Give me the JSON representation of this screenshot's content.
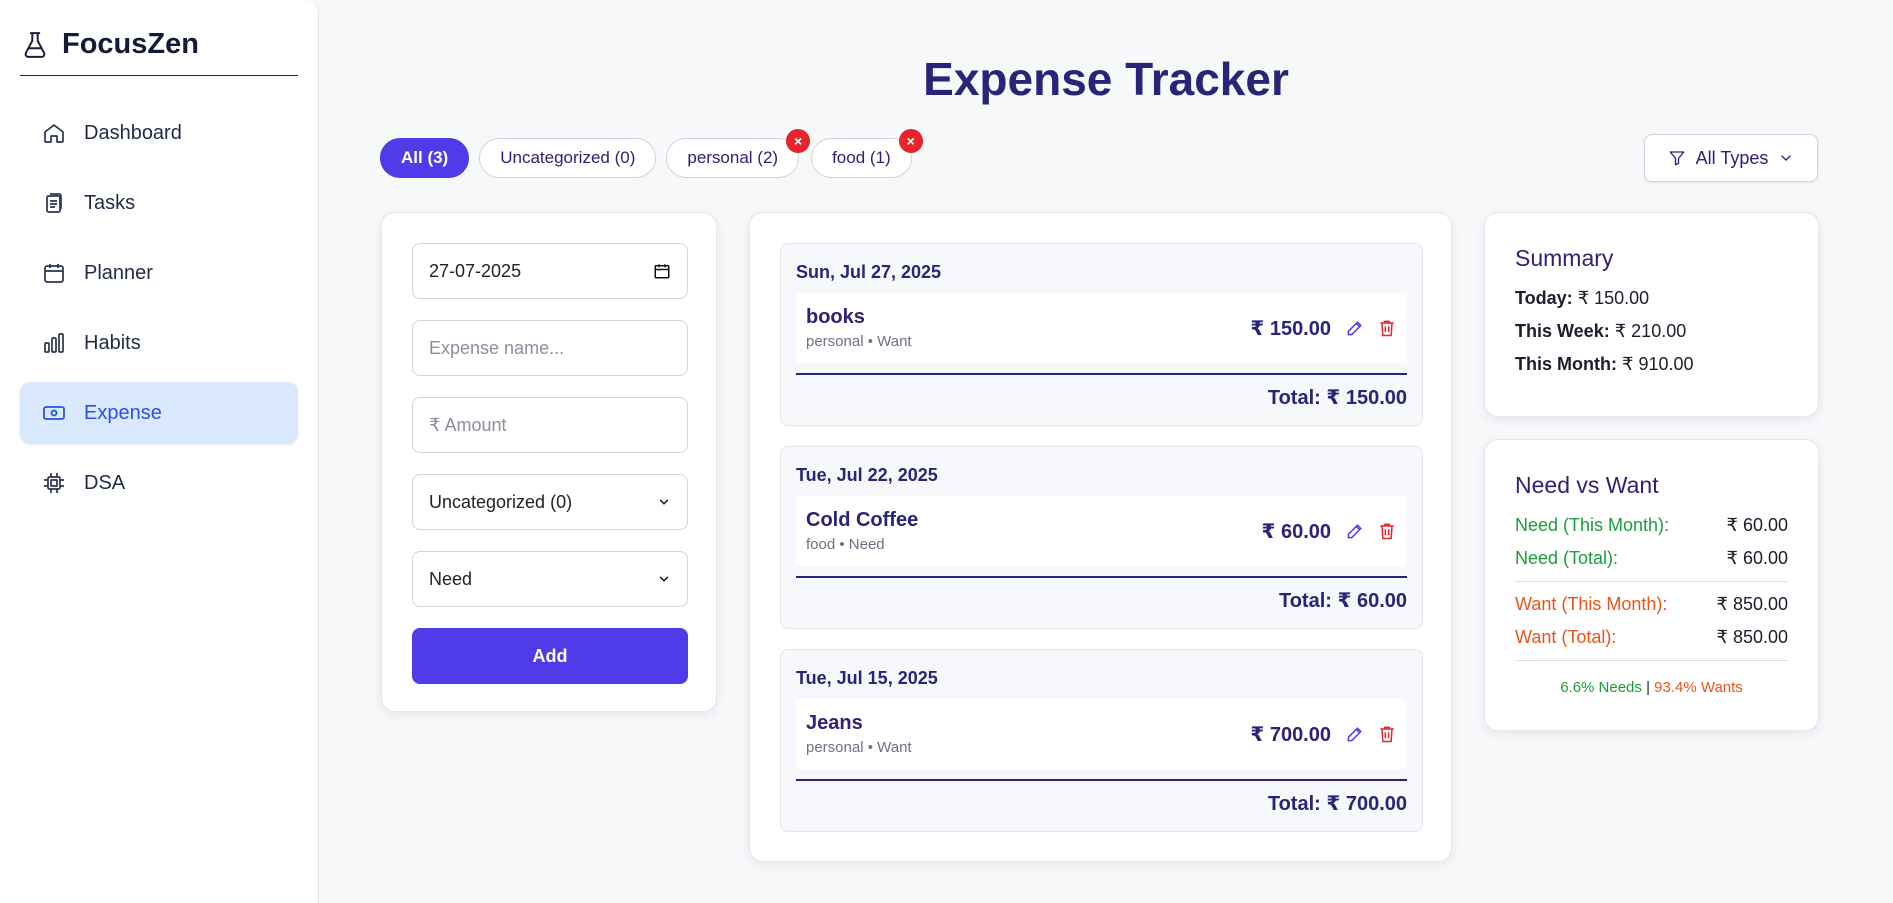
{
  "app": {
    "name": "FocusZen",
    "logo_icon": "flask-icon"
  },
  "sidebar": {
    "items": [
      {
        "label": "Dashboard",
        "icon": "home-icon"
      },
      {
        "label": "Tasks",
        "icon": "clipboard-icon"
      },
      {
        "label": "Planner",
        "icon": "calendar-icon"
      },
      {
        "label": "Habits",
        "icon": "bar-chart-icon"
      },
      {
        "label": "Expense",
        "icon": "cash-icon",
        "active": true
      },
      {
        "label": "DSA",
        "icon": "chip-icon"
      }
    ]
  },
  "page": {
    "title": "Expense Tracker"
  },
  "filters": {
    "chips": [
      {
        "label": "All (3)",
        "active": true
      },
      {
        "label": "Uncategorized (0)"
      },
      {
        "label": "personal (2)",
        "removable": true,
        "remove_glyph": "×"
      },
      {
        "label": "food (1)",
        "removable": true,
        "remove_glyph": "×"
      }
    ],
    "type_filter": "All Types"
  },
  "form": {
    "date_value": "27-07-2025",
    "name_placeholder": "Expense name...",
    "amount_placeholder": "₹ Amount",
    "category_value": "Uncategorized (0)",
    "type_value": "Need",
    "add_label": "Add"
  },
  "groups": [
    {
      "date": "Sun, Jul 27, 2025",
      "name": "books",
      "meta": "personal • Want",
      "amount": "₹ 150.00",
      "total": "Total: ₹ 150.00"
    },
    {
      "date": "Tue, Jul 22, 2025",
      "name": "Cold Coffee",
      "meta": "food • Need",
      "amount": "₹ 60.00",
      "total": "Total: ₹ 60.00"
    },
    {
      "date": "Tue, Jul 15, 2025",
      "name": "Jeans",
      "meta": "personal • Want",
      "amount": "₹ 700.00",
      "total": "Total: ₹ 700.00"
    }
  ],
  "summary": {
    "title": "Summary",
    "today_label": "Today:",
    "today_value": "₹ 150.00",
    "week_label": "This Week:",
    "week_value": "₹ 210.00",
    "month_label": "This Month:",
    "month_value": "₹ 910.00"
  },
  "need_want": {
    "title": "Need vs Want",
    "need_month_label": "Need (This Month):",
    "need_month_value": "₹ 60.00",
    "need_total_label": "Need (Total):",
    "need_total_value": "₹ 60.00",
    "want_month_label": "Want (This Month):",
    "want_month_value": "₹ 850.00",
    "want_total_label": "Want (Total):",
    "want_total_value": "₹ 850.00",
    "needs_pct": "6.6% Needs",
    "sep": "|",
    "wants_pct": "93.4% Wants"
  },
  "colors": {
    "accent": "#4f3ce8",
    "title": "#2a2478",
    "need": "#1a9d3a",
    "want": "#e8551a",
    "danger": "#e5242b",
    "active_bg": "#dbe9ff"
  }
}
